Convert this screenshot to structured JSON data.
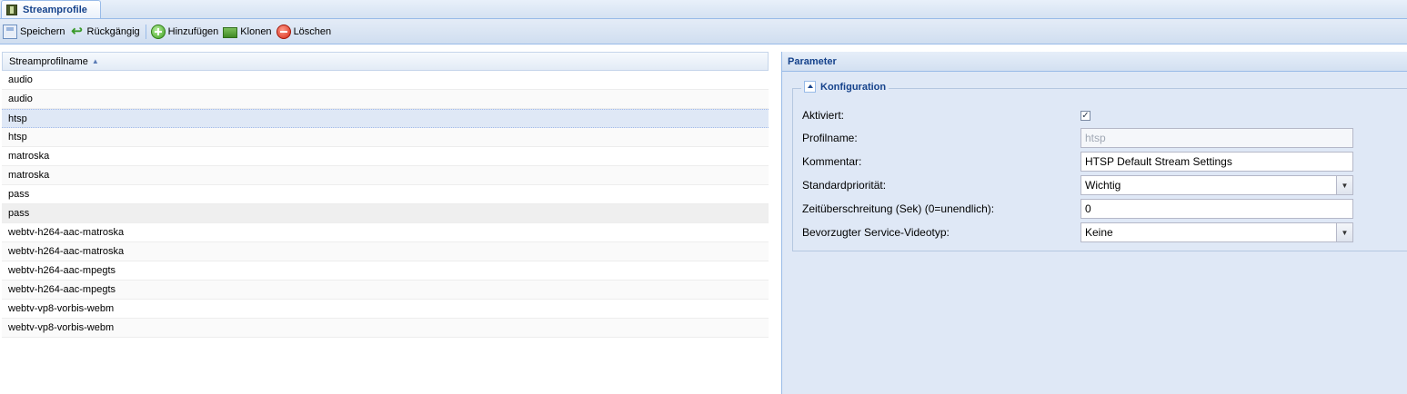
{
  "tab": {
    "label": "Streamprofile"
  },
  "toolbar": {
    "save": "Speichern",
    "undo": "Rückgängig",
    "add": "Hinzufügen",
    "clone": "Klonen",
    "delete": "Löschen"
  },
  "grid": {
    "column": "Streamprofilname",
    "rows": [
      "audio",
      "audio",
      "htsp",
      "htsp",
      "matroska",
      "matroska",
      "pass",
      "pass",
      "webtv-h264-aac-matroska",
      "webtv-h264-aac-matroska",
      "webtv-h264-aac-mpegts",
      "webtv-h264-aac-mpegts",
      "webtv-vp8-vorbis-webm",
      "webtv-vp8-vorbis-webm"
    ]
  },
  "panel": {
    "title": "Parameter",
    "fieldset_title": "Konfiguration",
    "fields": {
      "enabled_label": "Aktiviert:",
      "enabled_checked": true,
      "name_label": "Profilname:",
      "name_value": "htsp",
      "comment_label": "Kommentar:",
      "comment_value": "HTSP Default Stream Settings",
      "priority_label": "Standardpriorität:",
      "priority_value": "Wichtig",
      "timeout_label": "Zeitüberschreitung (Sek) (0=unendlich):",
      "timeout_value": "0",
      "videotype_label": "Bevorzugter Service-Videotyp:",
      "videotype_value": "Keine"
    }
  }
}
